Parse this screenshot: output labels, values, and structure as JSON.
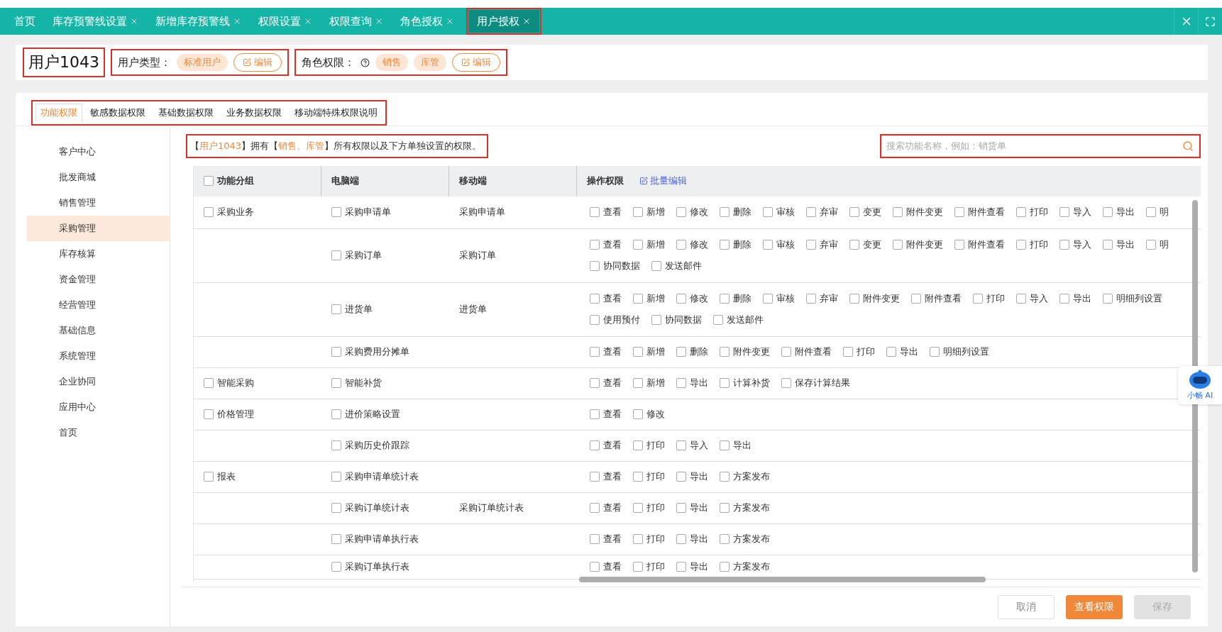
{
  "tabs": [
    {
      "label": "首页",
      "closable": false,
      "selected": false
    },
    {
      "label": "库存预警线设置",
      "closable": true,
      "selected": false
    },
    {
      "label": "新增库存预警线",
      "closable": true,
      "selected": false
    },
    {
      "label": "权限设置",
      "closable": true,
      "selected": false
    },
    {
      "label": "权限查询",
      "closable": true,
      "selected": false
    },
    {
      "label": "角色授权",
      "closable": true,
      "selected": false
    },
    {
      "label": "用户授权",
      "closable": true,
      "selected": true
    }
  ],
  "header": {
    "title": "用户1043",
    "user_type": {
      "label": "用户类型：",
      "tags": [
        "标准用户"
      ],
      "edit": "编辑"
    },
    "roles": {
      "label": "角色权限：",
      "tags": [
        "销售",
        "库管"
      ],
      "edit": "编辑"
    }
  },
  "sub_tabs": [
    {
      "label": "功能权限",
      "selected": true
    },
    {
      "label": "敏感数据权限",
      "selected": false
    },
    {
      "label": "基础数据权限",
      "selected": false
    },
    {
      "label": "业务数据权限",
      "selected": false
    },
    {
      "label": "移动端特殊权限说明",
      "selected": false
    }
  ],
  "sidebar": {
    "items": [
      {
        "label": "客户中心",
        "selected": false
      },
      {
        "label": "批发商城",
        "selected": false
      },
      {
        "label": "销售管理",
        "selected": false
      },
      {
        "label": "采购管理",
        "selected": true
      },
      {
        "label": "库存核算",
        "selected": false
      },
      {
        "label": "资金管理",
        "selected": false
      },
      {
        "label": "经营管理",
        "selected": false
      },
      {
        "label": "基础信息",
        "selected": false
      },
      {
        "label": "系统管理",
        "selected": false
      },
      {
        "label": "企业协同",
        "selected": false
      },
      {
        "label": "应用中心",
        "selected": false
      },
      {
        "label": "首页",
        "selected": false
      }
    ]
  },
  "summary": "【**用户1043**】拥有【**销售、库管**】所有权限以及下方单独设置的权限。",
  "search": {
    "placeholder": "搜索功能名称，例如：销货单"
  },
  "table": {
    "columns": [
      "功能分组",
      "电脑端",
      "移动端",
      "操作权限"
    ],
    "select_all_checked": false,
    "batch_edit": "批量编辑",
    "rows": [
      {
        "group": {
          "label": "采购业务",
          "checked": false
        },
        "pc": {
          "label": "采购申请单",
          "checked": false
        },
        "mobile": "采购申请单",
        "ops": [
          [
            {
              "label": "查看",
              "checked": false
            },
            {
              "label": "新增",
              "checked": false
            },
            {
              "label": "修改",
              "checked": false
            },
            {
              "label": "删除",
              "checked": false
            },
            {
              "label": "审核",
              "checked": false
            },
            {
              "label": "弃审",
              "checked": false
            },
            {
              "label": "变更",
              "checked": false
            },
            {
              "label": "附件变更",
              "checked": false
            },
            {
              "label": "附件查看",
              "checked": false
            },
            {
              "label": "打印",
              "checked": false
            },
            {
              "label": "导入",
              "checked": false
            },
            {
              "label": "导出",
              "checked": false
            },
            {
              "label": "明",
              "checked": false
            }
          ]
        ]
      },
      {
        "pc": {
          "label": "采购订单",
          "checked": false
        },
        "mobile": "采购订单",
        "ops": [
          [
            {
              "label": "查看",
              "checked": false
            },
            {
              "label": "新增",
              "checked": false
            },
            {
              "label": "修改",
              "checked": false
            },
            {
              "label": "删除",
              "checked": false
            },
            {
              "label": "审核",
              "checked": false
            },
            {
              "label": "弃审",
              "checked": false
            },
            {
              "label": "变更",
              "checked": false
            },
            {
              "label": "附件变更",
              "checked": false
            },
            {
              "label": "附件查看",
              "checked": false
            },
            {
              "label": "打印",
              "checked": false
            },
            {
              "label": "导入",
              "checked": false
            },
            {
              "label": "导出",
              "checked": false
            },
            {
              "label": "明",
              "checked": false
            }
          ],
          [
            {
              "label": "协同数据",
              "checked": false
            },
            {
              "label": "发送邮件",
              "checked": false
            }
          ]
        ]
      },
      {
        "pc": {
          "label": "进货单",
          "checked": false
        },
        "mobile": "进货单",
        "ops": [
          [
            {
              "label": "查看",
              "checked": false
            },
            {
              "label": "新增",
              "checked": false
            },
            {
              "label": "修改",
              "checked": false
            },
            {
              "label": "删除",
              "checked": false
            },
            {
              "label": "审核",
              "checked": false
            },
            {
              "label": "弃审",
              "checked": false
            },
            {
              "label": "附件变更",
              "checked": false
            },
            {
              "label": "附件查看",
              "checked": false
            },
            {
              "label": "打印",
              "checked": false
            },
            {
              "label": "导入",
              "checked": false
            },
            {
              "label": "导出",
              "checked": false
            },
            {
              "label": "明细列设置",
              "checked": false
            }
          ],
          [
            {
              "label": "使用预付",
              "checked": false
            },
            {
              "label": "协同数据",
              "checked": false
            },
            {
              "label": "发送邮件",
              "checked": false
            }
          ]
        ]
      },
      {
        "pc": {
          "label": "采购费用分摊单",
          "checked": false
        },
        "ops": [
          [
            {
              "label": "查看",
              "checked": false
            },
            {
              "label": "新增",
              "checked": false
            },
            {
              "label": "删除",
              "checked": false
            },
            {
              "label": "附件变更",
              "checked": false
            },
            {
              "label": "附件查看",
              "checked": false
            },
            {
              "label": "打印",
              "checked": false
            },
            {
              "label": "导出",
              "checked": false
            },
            {
              "label": "明细列设置",
              "checked": false
            }
          ]
        ]
      },
      {
        "group": {
          "label": "智能采购",
          "checked": false
        },
        "pc": {
          "label": "智能补货",
          "checked": false
        },
        "ops": [
          [
            {
              "label": "查看",
              "checked": false
            },
            {
              "label": "新增",
              "checked": false
            },
            {
              "label": "导出",
              "checked": false
            },
            {
              "label": "计算补货",
              "checked": false
            },
            {
              "label": "保存计算结果",
              "checked": false
            }
          ]
        ]
      },
      {
        "group": {
          "label": "价格管理",
          "checked": false
        },
        "pc": {
          "label": "进价策略设置",
          "checked": false
        },
        "ops": [
          [
            {
              "label": "查看",
              "checked": false
            },
            {
              "label": "修改",
              "checked": false
            }
          ]
        ]
      },
      {
        "pc": {
          "label": "采购历史价跟踪",
          "checked": false
        },
        "ops": [
          [
            {
              "label": "查看",
              "checked": false
            },
            {
              "label": "打印",
              "checked": false
            },
            {
              "label": "导入",
              "checked": false
            },
            {
              "label": "导出",
              "checked": false
            }
          ]
        ]
      },
      {
        "group": {
          "label": "报表",
          "checked": false
        },
        "pc": {
          "label": "采购申请单统计表",
          "checked": false
        },
        "ops": [
          [
            {
              "label": "查看",
              "checked": false
            },
            {
              "label": "打印",
              "checked": false
            },
            {
              "label": "导出",
              "checked": false
            },
            {
              "label": "方案发布",
              "checked": false
            }
          ]
        ]
      },
      {
        "pc": {
          "label": "采购订单统计表",
          "checked": false
        },
        "mobile": "采购订单统计表",
        "ops": [
          [
            {
              "label": "查看",
              "checked": false
            },
            {
              "label": "打印",
              "checked": false
            },
            {
              "label": "导出",
              "checked": false
            },
            {
              "label": "方案发布",
              "checked": false
            }
          ]
        ]
      },
      {
        "pc": {
          "label": "采购申请单执行表",
          "checked": false
        },
        "ops": [
          [
            {
              "label": "查看",
              "checked": false
            },
            {
              "label": "打印",
              "checked": false
            },
            {
              "label": "导出",
              "checked": false
            },
            {
              "label": "方案发布",
              "checked": false
            }
          ]
        ]
      },
      {
        "pc": {
          "label": "采购订单执行表",
          "checked": false
        },
        "ops": [
          [
            {
              "label": "查看",
              "checked": false
            },
            {
              "label": "打印",
              "checked": false
            },
            {
              "label": "导出",
              "checked": false
            },
            {
              "label": "方案发布",
              "checked": false
            }
          ]
        ]
      }
    ]
  },
  "footer_buttons": [
    {
      "label": "取消",
      "kind": "default"
    },
    {
      "label": "查看权限",
      "kind": "primary"
    },
    {
      "label": "保存",
      "kind": "disabled"
    }
  ],
  "assistant": {
    "label": "小畅 AI"
  }
}
